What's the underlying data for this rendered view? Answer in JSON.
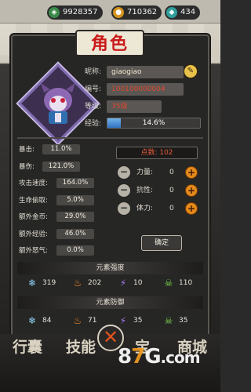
{
  "currency": {
    "jade": "9928357",
    "coin": "710362",
    "gem": "434"
  },
  "title": "角色",
  "profile": {
    "nickname_label": "昵称:",
    "nickname": "giaogiao",
    "id_label": "编号:",
    "id": "100100000004",
    "level_label": "等级:",
    "level": "35级",
    "exp_label": "经验:",
    "exp_text": "14.6%",
    "exp_percent": 14.6
  },
  "stats": [
    {
      "label": "暴击:",
      "value": "11.0%"
    },
    {
      "label": "暴伤:",
      "value": "121.0%"
    },
    {
      "label": "攻击速度:",
      "value": "164.0%"
    },
    {
      "label": "生命偷取:",
      "value": "5.0%"
    },
    {
      "label": "额外金币:",
      "value": "29.0%"
    },
    {
      "label": "额外经验:",
      "value": "46.0%"
    },
    {
      "label": "额外怒气:",
      "value": "0.0%"
    }
  ],
  "points": {
    "header": "点数: 102",
    "rows": [
      {
        "label": "力量:",
        "value": "0"
      },
      {
        "label": "抗性:",
        "value": "0"
      },
      {
        "label": "体力:",
        "value": "0"
      }
    ],
    "confirm": "确定"
  },
  "element_strength": {
    "header": "元素强度",
    "items": [
      {
        "icon": "ice-icon",
        "value": "319"
      },
      {
        "icon": "fire-icon",
        "value": "202"
      },
      {
        "icon": "lightning-icon",
        "value": "10"
      },
      {
        "icon": "poison-skull-icon",
        "value": "110"
      }
    ]
  },
  "element_defense": {
    "header": "元素防御",
    "items": [
      {
        "icon": "ice-icon",
        "value": "84"
      },
      {
        "icon": "fire-icon",
        "value": "71"
      },
      {
        "icon": "lightning-icon",
        "value": "35"
      },
      {
        "icon": "poison-skull-icon",
        "value": "35"
      }
    ]
  },
  "bottom_nav": [
    "行囊",
    "技能",
    "宝",
    "商城"
  ],
  "watermark": {
    "a": "8",
    "b": "7",
    "c": "G",
    "d": ".com"
  },
  "colors": {
    "accent": "#e38a1c",
    "title_red": "#c91a1a",
    "exp_blue": "#2f72c0",
    "points_red": "#e55b3a"
  }
}
